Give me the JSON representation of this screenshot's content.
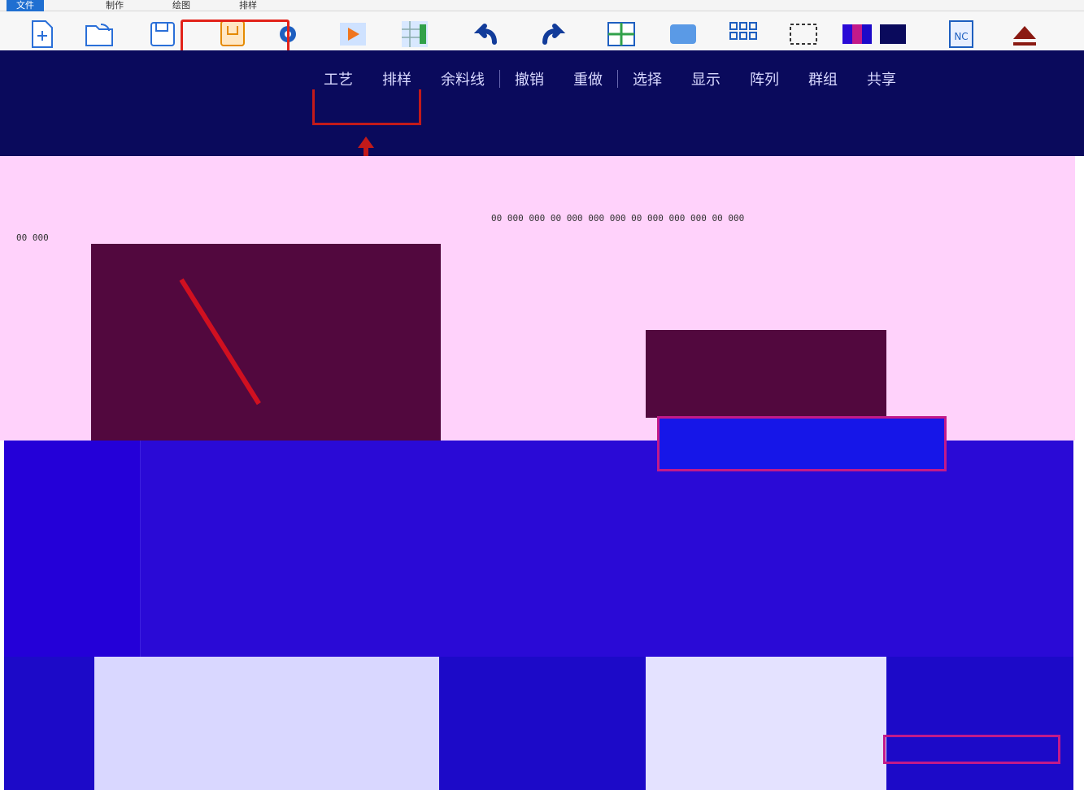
{
  "tabs": [
    "文件",
    "制作",
    "绘图",
    "排样"
  ],
  "ribbon": {
    "icons": [
      "new-file-icon",
      "open-folder-icon",
      "save-icon",
      "template-icon",
      "settings-icon",
      "run-icon",
      "grid-layout-icon",
      "undo-icon",
      "redo-icon",
      "window-icon",
      "panel-icon",
      "array-icon",
      "selection-icon",
      "color-block-icon",
      "dark-block-icon",
      "nc-file-icon",
      "eject-icon"
    ],
    "nc_label": "NC"
  },
  "menu": {
    "items": [
      "工艺",
      "排样",
      "余料线",
      "撤销",
      "重做",
      "选择",
      "显示",
      "阵列",
      "群组",
      "共享"
    ]
  },
  "ruler": {
    "line1": "00 000 000 00 000     000 000 00 000     000 000 00 000",
    "line2": "00 000"
  },
  "colors": {
    "navy": "#0a0a5c",
    "pink": "#ffd2fb",
    "blue": "#2a0ad6",
    "highlight": "#e2231a"
  }
}
